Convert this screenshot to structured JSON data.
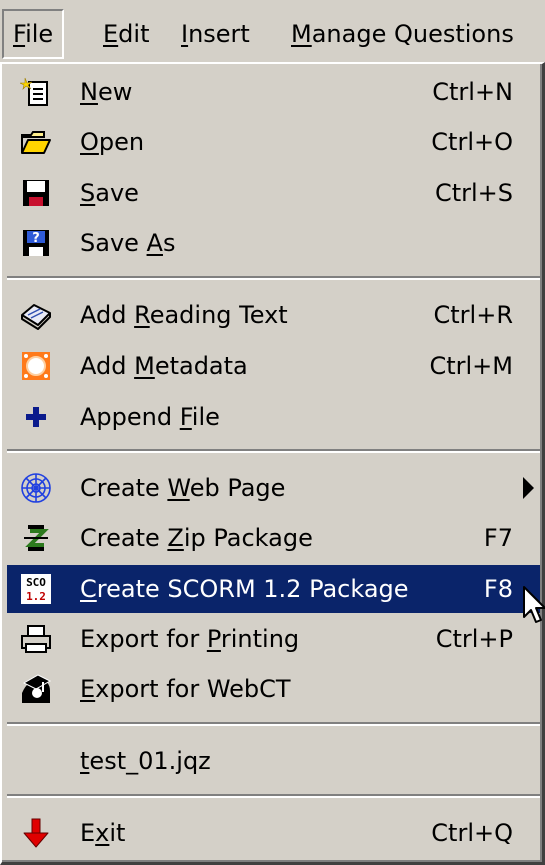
{
  "menubar": {
    "items": [
      {
        "pre": "",
        "mn": "F",
        "post": "ile"
      },
      {
        "pre": "",
        "mn": "E",
        "post": "dit"
      },
      {
        "pre": "",
        "mn": "I",
        "post": "nsert"
      },
      {
        "pre": "",
        "mn": "M",
        "post": "anage Questions"
      }
    ]
  },
  "menu": {
    "items": [
      {
        "pre": "",
        "mn": "N",
        "post": "ew",
        "shortcut": "Ctrl+N",
        "icon": "new-icon"
      },
      {
        "pre": "",
        "mn": "O",
        "post": "pen",
        "shortcut": "Ctrl+O",
        "icon": "open-folder-icon"
      },
      {
        "pre": "",
        "mn": "S",
        "post": "ave",
        "shortcut": "Ctrl+S",
        "icon": "save-disk-icon"
      },
      {
        "pre": "Save ",
        "mn": "A",
        "post": "s",
        "shortcut": "",
        "icon": "save-as-icon"
      },
      {
        "pre": "Add ",
        "mn": "R",
        "post": "eading Text",
        "shortcut": "Ctrl+R",
        "icon": "book-icon"
      },
      {
        "pre": "Add ",
        "mn": "M",
        "post": "etadata",
        "shortcut": "Ctrl+M",
        "icon": "metadata-icon"
      },
      {
        "pre": "Append ",
        "mn": "F",
        "post": "ile",
        "shortcut": "",
        "icon": "plus-icon"
      },
      {
        "pre": "Create ",
        "mn": "W",
        "post": "eb Page",
        "shortcut": "",
        "icon": "web-icon"
      },
      {
        "pre": "Create ",
        "mn": "Z",
        "post": "ip Package",
        "shortcut": "F7",
        "icon": "zip-icon"
      },
      {
        "pre": "",
        "mn": "C",
        "post": "reate SCORM 1.2 Package",
        "shortcut": "F8",
        "icon": "scorm-icon"
      },
      {
        "pre": "Export for ",
        "mn": "P",
        "post": "rinting",
        "shortcut": "Ctrl+P",
        "icon": "printer-icon"
      },
      {
        "pre": "",
        "mn": "E",
        "post": "xport for WebCT",
        "shortcut": "",
        "icon": "webct-icon"
      },
      {
        "pre": "",
        "mn": "t",
        "post": "est_01.jqz",
        "shortcut": "",
        "icon": ""
      },
      {
        "pre": "E",
        "mn": "x",
        "post": "it",
        "shortcut": "Ctrl+Q",
        "icon": "exit-arrow-icon"
      }
    ]
  },
  "scorm_icon_text": {
    "top": "SCO",
    "bottom": "1.2"
  },
  "colors": {
    "menu_bg": "#d4d0c8",
    "highlight": "#0a246a",
    "highlight_text": "#ffffff"
  }
}
